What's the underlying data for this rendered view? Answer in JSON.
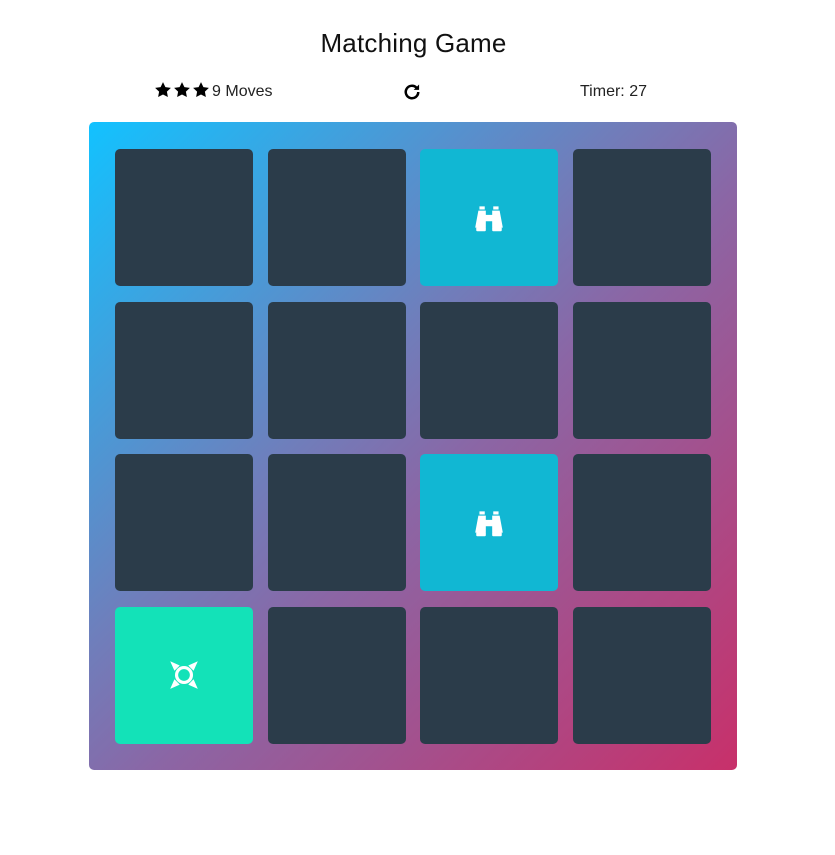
{
  "title": "Matching Game",
  "score_panel": {
    "star_rating": 3,
    "stars": [
      "star-icon",
      "star-icon",
      "star-icon"
    ],
    "moves_count": "9",
    "moves_label": "Moves",
    "restart_icon": "redo-icon",
    "timer_label": "Timer:",
    "timer_value": "27"
  },
  "colors": {
    "card_hidden": "#2b3c4a",
    "card_open": "#11b7d3",
    "card_match": "#13e2b8",
    "deck_gradient_start": "#12c2ff",
    "deck_gradient_end": "#c8306a"
  },
  "deck": {
    "rows": 4,
    "cols": 4,
    "cards": [
      {
        "state": "hidden",
        "icon": ""
      },
      {
        "state": "hidden",
        "icon": ""
      },
      {
        "state": "open",
        "icon": "binoculars-icon"
      },
      {
        "state": "hidden",
        "icon": ""
      },
      {
        "state": "hidden",
        "icon": ""
      },
      {
        "state": "hidden",
        "icon": ""
      },
      {
        "state": "hidden",
        "icon": ""
      },
      {
        "state": "hidden",
        "icon": ""
      },
      {
        "state": "hidden",
        "icon": ""
      },
      {
        "state": "hidden",
        "icon": ""
      },
      {
        "state": "open",
        "icon": "binoculars-icon"
      },
      {
        "state": "hidden",
        "icon": ""
      },
      {
        "state": "match",
        "icon": "life-ring-icon"
      },
      {
        "state": "hidden",
        "icon": ""
      },
      {
        "state": "hidden",
        "icon": ""
      },
      {
        "state": "hidden",
        "icon": ""
      }
    ]
  }
}
